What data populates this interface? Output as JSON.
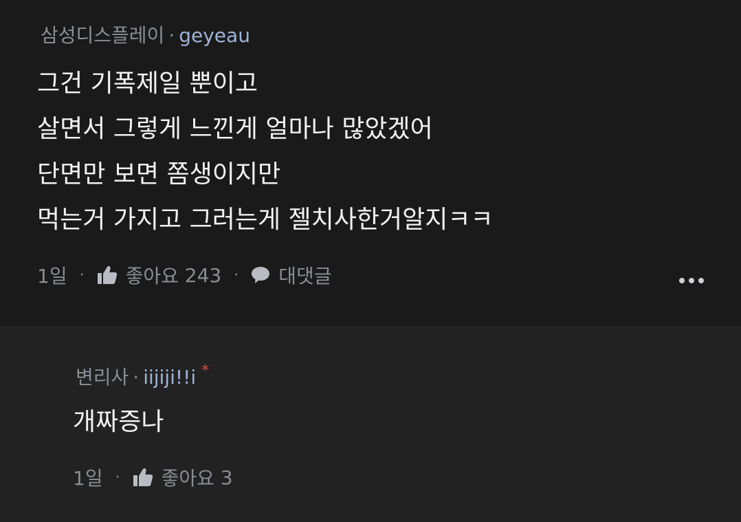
{
  "comments": [
    {
      "company": "삼성디스플레이",
      "separator": "·",
      "nickname": "geyeau",
      "lines": [
        "그건 기폭제일 뿐이고",
        "살면서 그렇게 느낀게 얼마나 많았겠어",
        "단면만 보면 쫌생이지만",
        "먹는거 가지고 그러는게 젤치사한거알지ㅋㅋ"
      ],
      "time": "1일",
      "like_label": "좋아요",
      "like_count": "243",
      "reply_label": "대댓글",
      "icons": {
        "like": "thumbs-up-icon",
        "reply": "speech-bubble-icon",
        "more": "more-dots-icon"
      }
    },
    {
      "company": "변리사",
      "separator": "·",
      "nickname": "iijiji!!i",
      "author_mark": "*",
      "lines": [
        "개짜증나"
      ],
      "time": "1일",
      "like_label": "좋아요",
      "like_count": "3",
      "icons": {
        "like": "thumbs-up-icon"
      }
    }
  ],
  "colors": {
    "background": "#1a1a1a",
    "reply_background": "#222222",
    "text": "#f2f2f2",
    "meta": "#8a8d93",
    "nickname": "#9fb4d6",
    "author_mark": "#e0443c"
  }
}
